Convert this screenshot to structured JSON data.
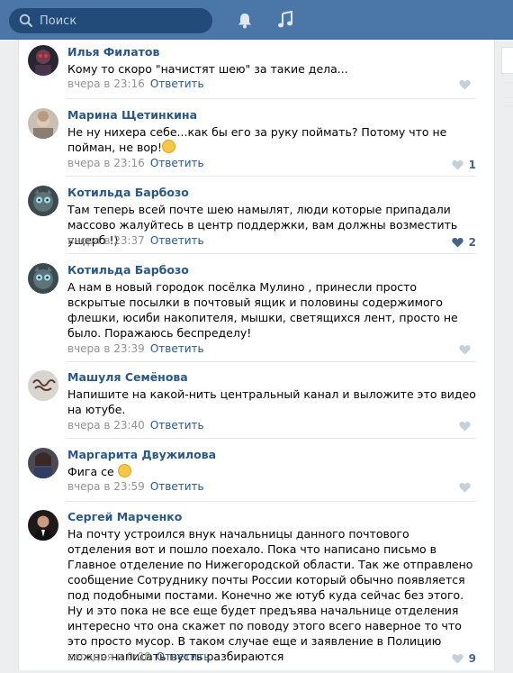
{
  "search": {
    "placeholder": "Поиск",
    "icon": "search-icon"
  },
  "header_icons": [
    "bell-icon",
    "music-icon"
  ],
  "comments": [
    {
      "author": "Илья Филатов",
      "text": "Кому то скоро \"начистят шею\" за такие дела...",
      "time": "вчера в 23:16",
      "reply": "Ответить",
      "likes": ""
    },
    {
      "author": "Марина Щетинкина",
      "text": "Не ну нихера себе...как бы его за руку поймать? Потому что не пойман, не вор!",
      "time": "вчера в 23:16",
      "reply": "Ответить",
      "likes": "1"
    },
    {
      "author": "Котильда Барбозо",
      "text": "Там теперь всей почте шею намылят, люди которые припадали массово жалуйтесь в центр поддержки, вам должны возместить ущерб !)",
      "time": "вчера в 23:37",
      "reply": "Ответить",
      "likes": "2"
    },
    {
      "author": "Котильда Барбозо",
      "text": "А нам в новый городок посёлка Мулино , принесли просто вскрытые посылки в почтовый ящик и половины содержимого флешки, юсиби накопителя, мышки, светящихся лент, просто не было. Поражаюсь беспределу!",
      "time": "вчера в 23:39",
      "reply": "Ответить",
      "likes": ""
    },
    {
      "author": "Машуля Семёнова",
      "text": "Напишите на какой-нить центральный канал и выложите это видео на ютубе.",
      "time": "вчера в 23:40",
      "reply": "Ответить",
      "likes": ""
    },
    {
      "author": "Маргарита Двужилова",
      "text": "Фига се",
      "time": "вчера в 23:59",
      "reply": "Ответить",
      "likes": ""
    },
    {
      "author": "Сергей Марченко",
      "text": "На почту устроился внук начальницы данного почтового отделения вот и пошло поехало. Пока что написано письмо в Главное отделение по Нижегородской области. Так же отправлено сообщение Сотруднику почты России который обычно появляется под подобными постами. Конечно же ютуб куда сейчас без этого. Ну и это пока не все еще будет предъява начальнице отделения интересно что она скажет по поводу этого всего наверное то что это просто мусор. В таком случае еще и заявление в Полицию можно написать пусть разбираются",
      "time": "сегодня в 0:08",
      "reply": "Ответить",
      "likes": "9"
    }
  ],
  "colors": {
    "header": "#4a76a8",
    "link": "#2a5885",
    "meta": "#939393",
    "like_active": "#42648b",
    "like_inactive": "#c5d0db"
  }
}
